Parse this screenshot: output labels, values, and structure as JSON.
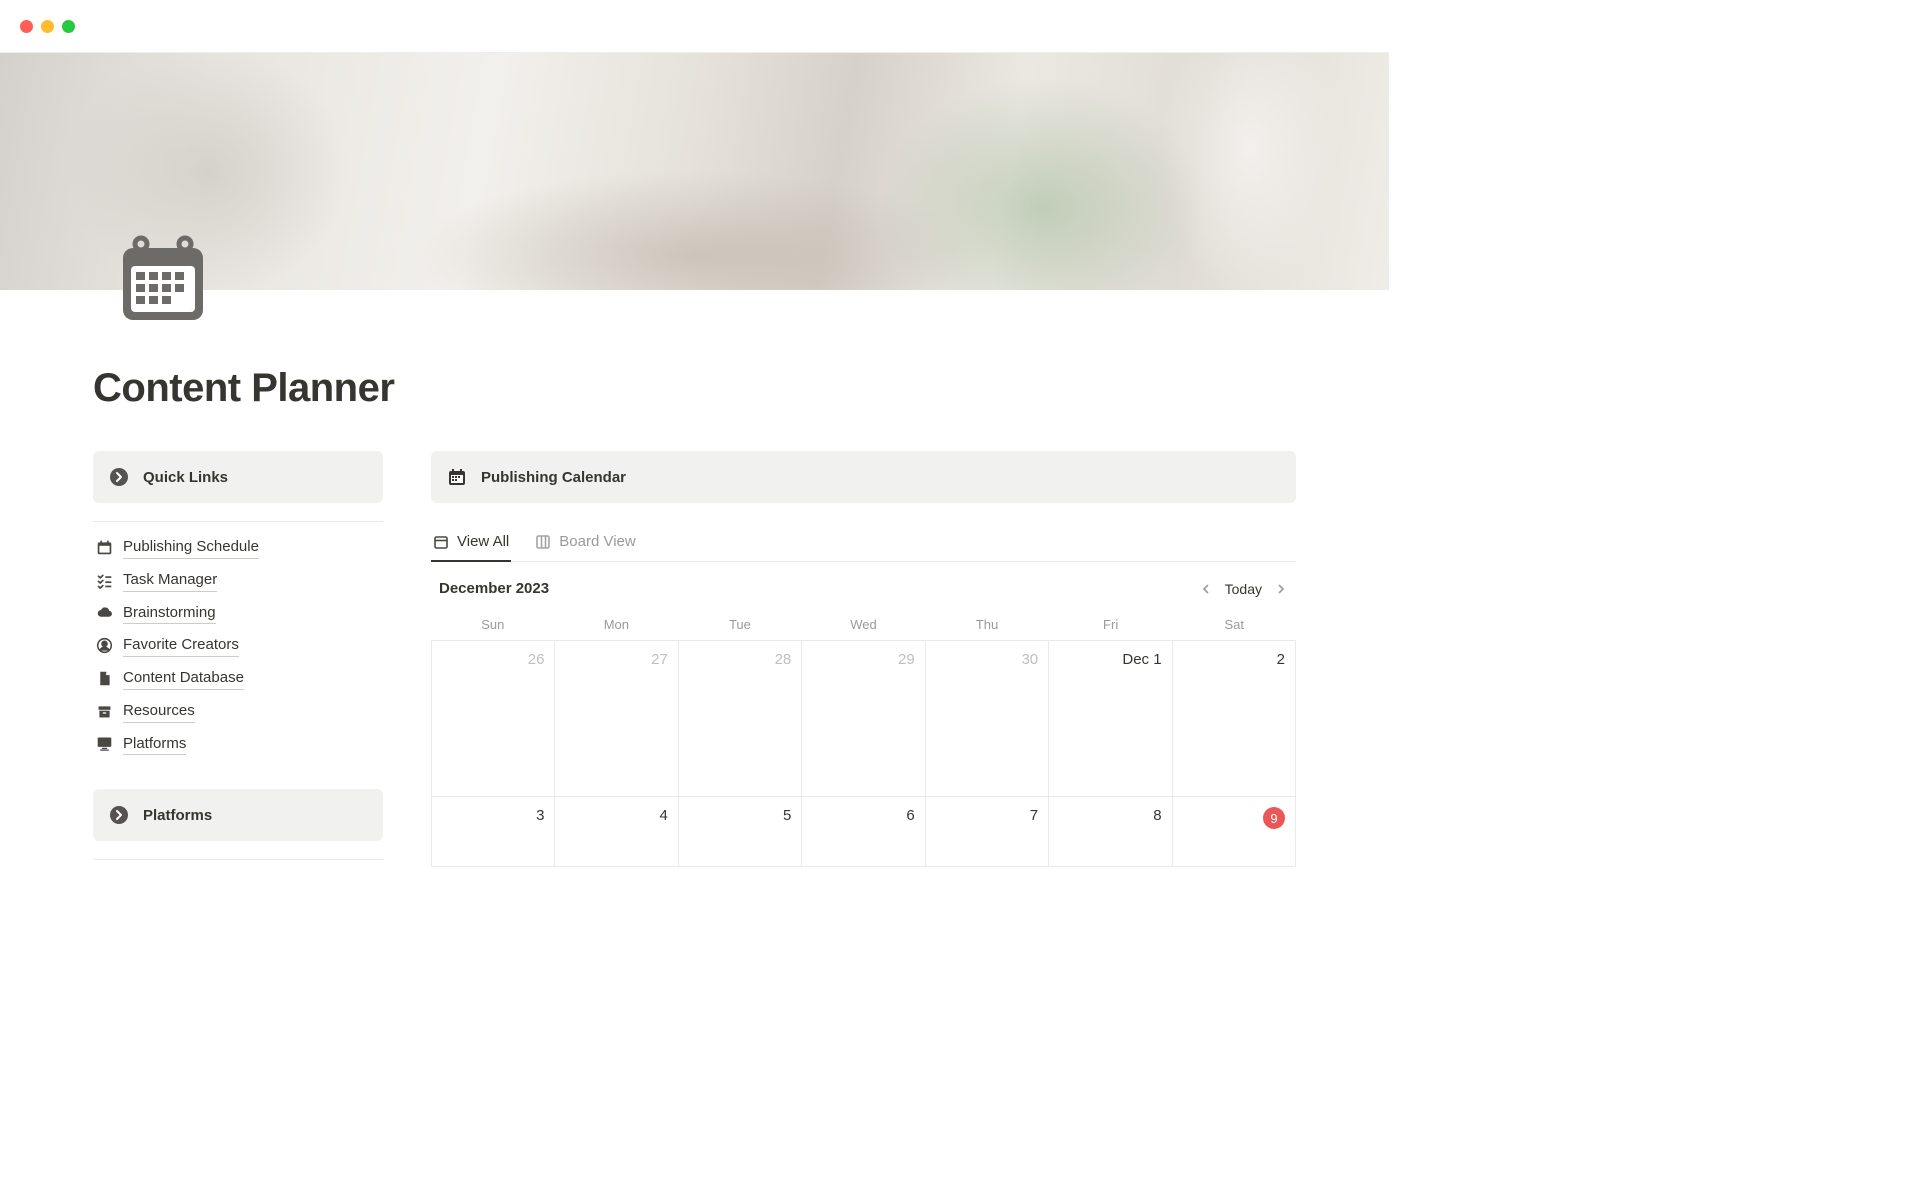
{
  "window": {
    "controls": [
      "close",
      "minimize",
      "zoom"
    ]
  },
  "page": {
    "title": "Content Planner",
    "icon": "calendar-icon"
  },
  "sidebar": {
    "sections": [
      {
        "header": {
          "icon": "arrow-circle-right-icon",
          "label": "Quick Links"
        },
        "items": [
          {
            "icon": "calendar-icon",
            "label": "Publishing Schedule"
          },
          {
            "icon": "task-list-icon",
            "label": "Task Manager"
          },
          {
            "icon": "cloud-icon",
            "label": "Brainstorming"
          },
          {
            "icon": "user-circle-icon",
            "label": "Favorite Creators"
          },
          {
            "icon": "document-icon",
            "label": "Content Database"
          },
          {
            "icon": "archive-icon",
            "label": "Resources"
          },
          {
            "icon": "monitor-icon",
            "label": "Platforms"
          }
        ]
      },
      {
        "header": {
          "icon": "arrow-circle-right-icon",
          "label": "Platforms"
        },
        "items": []
      }
    ]
  },
  "main": {
    "header": {
      "icon": "calendar-icon",
      "label": "Publishing Calendar"
    },
    "tabs": [
      {
        "icon": "calendar-small-icon",
        "label": "View All",
        "active": true
      },
      {
        "icon": "board-icon",
        "label": "Board View",
        "active": false
      }
    ],
    "calendar": {
      "month_label": "December 2023",
      "today_label": "Today",
      "daynames": [
        "Sun",
        "Mon",
        "Tue",
        "Wed",
        "Thu",
        "Fri",
        "Sat"
      ],
      "weeks": [
        [
          {
            "label": "26",
            "dim": true
          },
          {
            "label": "27",
            "dim": true
          },
          {
            "label": "28",
            "dim": true
          },
          {
            "label": "29",
            "dim": true
          },
          {
            "label": "30",
            "dim": true
          },
          {
            "label": "Dec 1",
            "dim": false
          },
          {
            "label": "2",
            "dim": false
          }
        ],
        [
          {
            "label": "3"
          },
          {
            "label": "4"
          },
          {
            "label": "5"
          },
          {
            "label": "6"
          },
          {
            "label": "7"
          },
          {
            "label": "8"
          },
          {
            "label": "9",
            "today": true
          }
        ]
      ]
    }
  }
}
